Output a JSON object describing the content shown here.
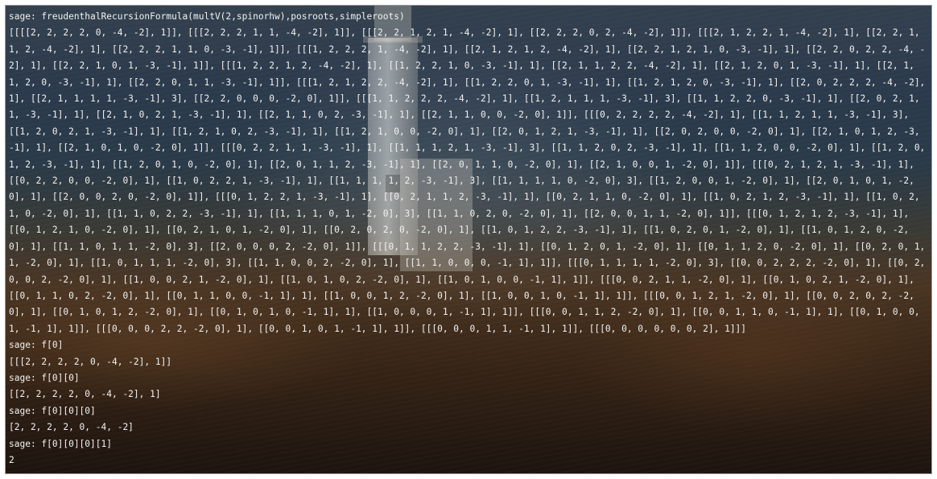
{
  "terminal": {
    "lines": [
      "sage: freudenthalRecursionFormula(multV(2,spinorhw),posroots,simpleroots)",
      "[[[[2, 2, 2, 2, 0, -4, -2], 1]], [[[2, 2, 2, 1, 1, -4, -2], 1]], [[[2, 2, 1, 2, 1, -4, -2], 1], [[2, 2, 2, 0, 2, -4, -2], 1]], [[[2, 1, 2, 2, 1, -4, -2], 1], [[2, 2, 1, 1, 2, -4, -2], 1], [[2, 2, 2, 1, 1, 0, -3, -1], 1]], [[[1, 2, 2, 2, 1, -4, -2], 1], [[2, 1, 2, 1, 2, -4, -2], 1], [[2, 2, 1, 2, 1, 0, -3, -1], 1], [[2, 2, 0, 2, 2, -4, -2], 1], [[2, 2, 1, 0, 1, -3, -1], 1]], [[[1, 2, 2, 1, 2, -4, -2], 1], [[1, 2, 2, 1, 0, -3, -1], 1], [[2, 1, 1, 2, 2, -4, -2], 1], [[2, 1, 2, 0, 1, -3, -1], 1], [[2, 1, 1, 2, 0, -3, -1], 1], [[2, 2, 0, 1, 1, -3, -1], 1]], [[[1, 2, 1, 2, 2, -4, -2], 1], [[1, 2, 2, 0, 1, -3, -1], 1], [[1, 2, 1, 2, 0, -3, -1], 1], [[2, 0, 2, 2, 2, -4, -2], 1], [[2, 1, 1, 1, 1, -3, -1], 3], [[2, 2, 0, 0, 0, -2, 0], 1]], [[[1, 1, 2, 2, 2, -4, -2], 1], [[1, 2, 1, 1, 1, -3, -1], 3], [[1, 1, 2, 2, 0, -3, -1], 1], [[2, 0, 2, 1, 1, -3, -1], 1], [[2, 1, 0, 2, 1, -3, -1], 1], [[2, 1, 1, 0, 2, -3, -1], 1], [[2, 1, 1, 0, 0, -2, 0], 1]], [[[0, 2, 2, 2, 2, -4, -2], 1], [[1, 1, 2, 1, 1, -3, -1], 3], [[1, 2, 0, 2, 1, -3, -1], 1], [[1, 2, 1, 0, 2, -3, -1], 1], [[1, 2, 1, 0, 0, -2, 0], 1], [[2, 0, 1, 2, 1, -3, -1], 1], [[2, 0, 2, 0, 0, -2, 0], 1], [[2, 1, 0, 1, 2, -3, -1], 1], [[2, 1, 0, 1, 0, -2, 0], 1]], [[[0, 2, 2, 1, 1, -3, -1], 1], [[1, 1, 1, 2, 1, -3, -1], 3], [[1, 1, 2, 0, 2, -3, -1], 1], [[1, 1, 2, 0, 0, -2, 0], 1], [[1, 2, 0, 1, 2, -3, -1], 1], [[1, 2, 0, 1, 0, -2, 0], 1], [[2, 0, 1, 1, 2, -3, -1], 1], [[2, 0, 1, 1, 0, -2, 0], 1], [[2, 1, 0, 0, 1, -2, 0], 1]], [[[0, 2, 1, 2, 1, -3, -1], 1], [[0, 2, 2, 0, 0, -2, 0], 1], [[1, 0, 2, 2, 1, -3, -1], 1], [[1, 1, 1, 1, 2, -3, -1], 3], [[1, 1, 1, 1, 0, -2, 0], 3], [[1, 2, 0, 0, 1, -2, 0], 1], [[2, 0, 1, 0, 1, -2, 0], 1], [[2, 0, 0, 2, 0, -2, 0], 1]], [[[0, 1, 2, 2, 1, -3, -1], 1], [[0, 2, 1, 1, 2, -3, -1], 1], [[0, 2, 1, 1, 0, -2, 0], 1], [[1, 0, 2, 1, 2, -3, -1], 1], [[1, 0, 2, 1, 0, -2, 0], 1], [[1, 1, 0, 2, 2, -3, -1], 1], [[1, 1, 1, 0, 1, -2, 0], 3], [[1, 1, 0, 2, 0, -2, 0], 1], [[2, 0, 0, 1, 1, -2, 0], 1]], [[[0, 1, 2, 1, 2, -3, -1], 1], [[0, 1, 2, 1, 0, -2, 0], 1], [[0, 2, 1, 0, 1, -2, 0], 1], [[0, 2, 0, 2, 0, -2, 0], 1], [[1, 0, 1, 2, 2, -3, -1], 1], [[1, 0, 2, 0, 1, -2, 0], 1], [[1, 0, 1, 2, 0, -2, 0], 1], [[1, 1, 0, 1, 1, -2, 0], 3], [[2, 0, 0, 0, 2, -2, 0], 1]], [[[0, 1, 1, 2, 2, -3, -1], 1], [[0, 1, 2, 0, 1, -2, 0], 1], [[0, 1, 1, 2, 0, -2, 0], 1], [[0, 2, 0, 1, 1, -2, 0], 1], [[1, 0, 1, 1, 1, -2, 0], 3], [[1, 1, 0, 0, 2, -2, 0], 1], [[1, 1, 0, 0, 0, -1, 1], 1]], [[[0, 1, 1, 1, 1, -2, 0], 3], [[0, 0, 2, 2, 2, -2, 0], 1], [[0, 2, 0, 0, 2, -2, 0], 1], [[1, 0, 0, 2, 1, -2, 0], 1], [[1, 0, 1, 0, 2, -2, 0], 1], [[1, 0, 1, 0, 0, -1, 1], 1]], [[[0, 0, 2, 1, 1, -2, 0], 1], [[0, 1, 0, 2, 1, -2, 0], 1], [[0, 1, 1, 0, 2, -2, 0], 1], [[0, 1, 1, 0, 0, -1, 1], 1], [[1, 0, 0, 1, 2, -2, 0], 1], [[1, 0, 0, 1, 0, -1, 1], 1]], [[[0, 0, 1, 2, 1, -2, 0], 1], [[0, 0, 2, 0, 2, -2, 0], 1], [[0, 1, 0, 1, 2, -2, 0], 1], [[0, 1, 0, 1, 0, -1, 1], 1], [[1, 0, 0, 0, 1, -1, 1], 1]], [[[0, 0, 1, 1, 2, -2, 0], 1], [[0, 0, 1, 1, 0, -1, 1], 1], [[0, 1, 0, 0, 1, -1, 1], 1]], [[[0, 0, 0, 2, 2, -2, 0], 1], [[0, 0, 1, 0, 1, -1, 1], 1]], [[[0, 0, 0, 1, 1, -1, 1], 1]], [[[0, 0, 0, 0, 0, 0, 2], 1]]]",
      "sage: f[0]",
      "[[[2, 2, 2, 2, 0, -4, -2], 1]]",
      "sage: f[0][0]",
      "[[2, 2, 2, 2, 0, -4, -2], 1]",
      "sage: f[0][0][0]",
      "[2, 2, 2, 2, 0, -4, -2]",
      "sage: f[0][0][0][1]",
      "2"
    ]
  }
}
